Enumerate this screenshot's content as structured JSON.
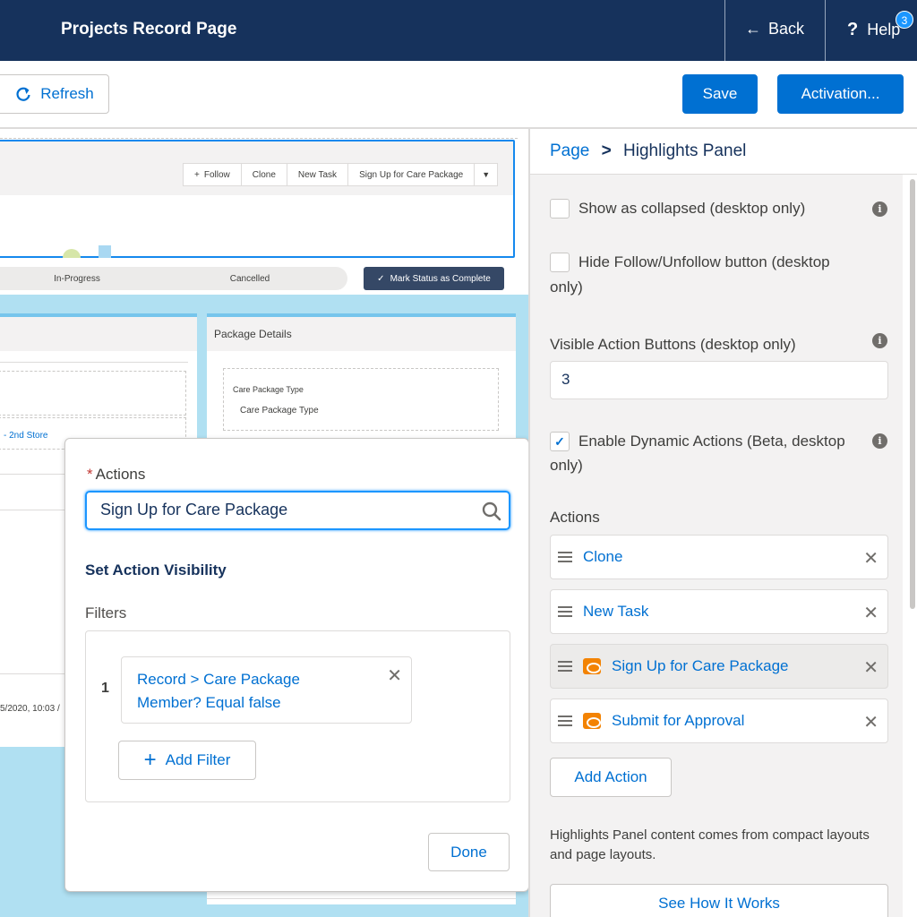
{
  "header": {
    "title": "Projects Record Page",
    "back_label": "Back",
    "help_label": "Help",
    "help_badge": "3"
  },
  "toolbar": {
    "refresh_label": "Refresh",
    "save_label": "Save",
    "activation_label": "Activation..."
  },
  "canvas": {
    "highlight_actions": [
      "Follow",
      "Clone",
      "New Task",
      "Sign Up for Care Package"
    ],
    "path_steps": [
      "In-Progress",
      "Cancelled"
    ],
    "mark_status_label": "Mark Status as Complete",
    "package_card_title": "Package Details",
    "care_package_type_label": "Care Package Type",
    "care_package_type_value": "Care Package Type",
    "store_link": "- 2nd Store",
    "date_text": "5/2020, 10:03 /"
  },
  "popover": {
    "actions_label": "Actions",
    "search_value": "Sign Up for Care Package",
    "visibility_heading": "Set Action Visibility",
    "filters_label": "Filters",
    "filter_index": "1",
    "filter_text_line1": "Record > Care Package",
    "filter_text_line2": "Member? Equal false",
    "add_filter_label": "Add Filter",
    "done_label": "Done"
  },
  "panel": {
    "breadcrumb_page": "Page",
    "breadcrumb_current": "Highlights Panel",
    "show_collapsed_label": "Show as collapsed (desktop only)",
    "hide_follow_label_line1": "Hide Follow/Unfollow button (desktop",
    "hide_follow_label_line2": "only)",
    "visible_buttons_label": "Visible Action Buttons (desktop only)",
    "visible_buttons_value": "3",
    "dynamic_actions_label_line1": "Enable Dynamic Actions (Beta, desktop",
    "dynamic_actions_label_line2": "only)",
    "actions_heading": "Actions",
    "actions": [
      {
        "label": "Clone",
        "has_visibility": false
      },
      {
        "label": "New Task",
        "has_visibility": false
      },
      {
        "label": "Sign Up for Care Package",
        "has_visibility": true
      },
      {
        "label": "Submit for Approval",
        "has_visibility": true
      }
    ],
    "add_action_label": "Add Action",
    "help_text": "Highlights Panel content comes from compact layouts and page layouts.",
    "see_how_label": "See How It Works"
  },
  "colors": {
    "header_bg": "#16325c",
    "brand": "#0070d2",
    "canvas_bg": "#b0e0f2",
    "visibility_icon": "#f38303"
  }
}
